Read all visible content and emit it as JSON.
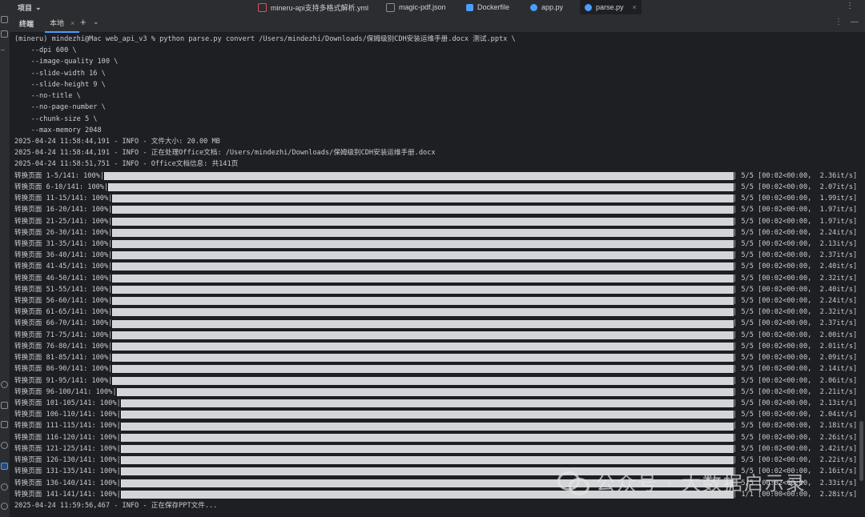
{
  "topbar": {
    "project_label": "项目",
    "tabs": [
      {
        "label": "mineru-api支持多格式解析.yml",
        "icon": "yaml-file-icon",
        "color": "#e05252"
      },
      {
        "label": "magic-pdf.json",
        "icon": "json-file-icon",
        "color": "#8a8d93"
      },
      {
        "label": "Dockerfile",
        "icon": "docker-file-icon",
        "color": "#4e9cff"
      },
      {
        "label": "app.py",
        "icon": "python-file-icon",
        "color": "#4e9cff"
      },
      {
        "label": "parse.py",
        "icon": "python-file-icon",
        "color": "#4e9cff"
      }
    ]
  },
  "terminal": {
    "title": "终端",
    "tab_label": "本地",
    "plus": "+",
    "chevron": "⌄",
    "more": "⋮",
    "minimize": "—",
    "command_lines": [
      "(mineru) mindezhi@Mac web_api_v3 % python parse.py convert /Users/mindezhi/Downloads/保姆级别CDH安装运维手册.docx 测试.pptx \\",
      "    --dpi 600 \\",
      "    --image-quality 100 \\",
      "    --slide-width 16 \\",
      "    --slide-height 9 \\",
      "    --no-title \\",
      "    --no-page-number \\",
      "    --chunk-size 5 \\",
      "    --max-memory 2048",
      "2025-04-24 11:58:44,191 - INFO - 文件大小: 20.00 MB",
      "2025-04-24 11:58:44,191 - INFO - 正在处理Office文档: /Users/mindezhi/Downloads/保姆级别CDH安装运维手册.docx",
      "2025-04-24 11:58:51,751 - INFO - Office文档信息: 共141页"
    ],
    "progress_rows": [
      {
        "label": "转换页面 1-5/141: 100%|",
        "suffix": "| 5/5 [00:02<00:00,  2.36it/s]",
        "percent": 100
      },
      {
        "label": "转换页面 6-10/141: 100%|",
        "suffix": "| 5/5 [00:02<00:00,  2.07it/s]",
        "percent": 100
      },
      {
        "label": "转换页面 11-15/141: 100%|",
        "suffix": "| 5/5 [00:02<00:00,  1.99it/s]",
        "percent": 100
      },
      {
        "label": "转换页面 16-20/141: 100%|",
        "suffix": "| 5/5 [00:02<00:00,  1.97it/s]",
        "percent": 100
      },
      {
        "label": "转换页面 21-25/141: 100%|",
        "suffix": "| 5/5 [00:02<00:00,  1.97it/s]",
        "percent": 100
      },
      {
        "label": "转换页面 26-30/141: 100%|",
        "suffix": "| 5/5 [00:02<00:00,  2.24it/s]",
        "percent": 100
      },
      {
        "label": "转换页面 31-35/141: 100%|",
        "suffix": "| 5/5 [00:02<00:00,  2.13it/s]",
        "percent": 100
      },
      {
        "label": "转换页面 36-40/141: 100%|",
        "suffix": "| 5/5 [00:02<00:00,  2.37it/s]",
        "percent": 100
      },
      {
        "label": "转换页面 41-45/141: 100%|",
        "suffix": "| 5/5 [00:02<00:00,  2.40it/s]",
        "percent": 100
      },
      {
        "label": "转换页面 46-50/141: 100%|",
        "suffix": "| 5/5 [00:02<00:00,  2.32it/s]",
        "percent": 100
      },
      {
        "label": "转换页面 51-55/141: 100%|",
        "suffix": "| 5/5 [00:02<00:00,  2.40it/s]",
        "percent": 100
      },
      {
        "label": "转换页面 56-60/141: 100%|",
        "suffix": "| 5/5 [00:02<00:00,  2.24it/s]",
        "percent": 100
      },
      {
        "label": "转换页面 61-65/141: 100%|",
        "suffix": "| 5/5 [00:02<00:00,  2.32it/s]",
        "percent": 100
      },
      {
        "label": "转换页面 66-70/141: 100%|",
        "suffix": "| 5/5 [00:02<00:00,  2.37it/s]",
        "percent": 100
      },
      {
        "label": "转换页面 71-75/141: 100%|",
        "suffix": "| 5/5 [00:02<00:00,  2.00it/s]",
        "percent": 100
      },
      {
        "label": "转换页面 76-80/141: 100%|",
        "suffix": "| 5/5 [00:02<00:00,  2.01it/s]",
        "percent": 100
      },
      {
        "label": "转换页面 81-85/141: 100%|",
        "suffix": "| 5/5 [00:02<00:00,  2.09it/s]",
        "percent": 100
      },
      {
        "label": "转换页面 86-90/141: 100%|",
        "suffix": "| 5/5 [00:02<00:00,  2.14it/s]",
        "percent": 100
      },
      {
        "label": "转换页面 91-95/141: 100%|",
        "suffix": "| 5/5 [00:02<00:00,  2.06it/s]",
        "percent": 100
      },
      {
        "label": "转换页面 96-100/141: 100%|",
        "suffix": "| 5/5 [00:02<00:00,  2.21it/s]",
        "percent": 100
      },
      {
        "label": "转换页面 101-105/141: 100%|",
        "suffix": "| 5/5 [00:02<00:00,  2.13it/s]",
        "percent": 100
      },
      {
        "label": "转换页面 106-110/141: 100%|",
        "suffix": "| 5/5 [00:02<00:00,  2.04it/s]",
        "percent": 100
      },
      {
        "label": "转换页面 111-115/141: 100%|",
        "suffix": "| 5/5 [00:02<00:00,  2.18it/s]",
        "percent": 100
      },
      {
        "label": "转换页面 116-120/141: 100%|",
        "suffix": "| 5/5 [00:02<00:00,  2.26it/s]",
        "percent": 100
      },
      {
        "label": "转换页面 121-125/141: 100%|",
        "suffix": "| 5/5 [00:02<00:00,  2.42it/s]",
        "percent": 100
      },
      {
        "label": "转换页面 126-130/141: 100%|",
        "suffix": "| 5/5 [00:02<00:00,  2.22it/s]",
        "percent": 100
      },
      {
        "label": "转换页面 131-135/141: 100%|",
        "suffix": "| 5/5 [00:02<00:00,  2.16it/s]",
        "percent": 100
      },
      {
        "label": "转换页面 136-140/141: 100%|",
        "suffix": "| 5/5 [00:02<00:00,  2.33it/s]",
        "percent": 100
      },
      {
        "label": "转换页面 141-141/141: 100%|",
        "suffix": "| 1/1 [00:00<00:00,  2.28it/s]",
        "percent": 100
      }
    ],
    "final_line": "2025-04-24 11:59:56,467 - INFO - 正在保存PPT文件..."
  },
  "watermark": {
    "text": "公众号 · 大数据启示录"
  },
  "colors": {
    "background": "#1e1f22",
    "panel": "#2b2d30",
    "accent": "#4e9cff",
    "bar": "#d4d5d8"
  }
}
